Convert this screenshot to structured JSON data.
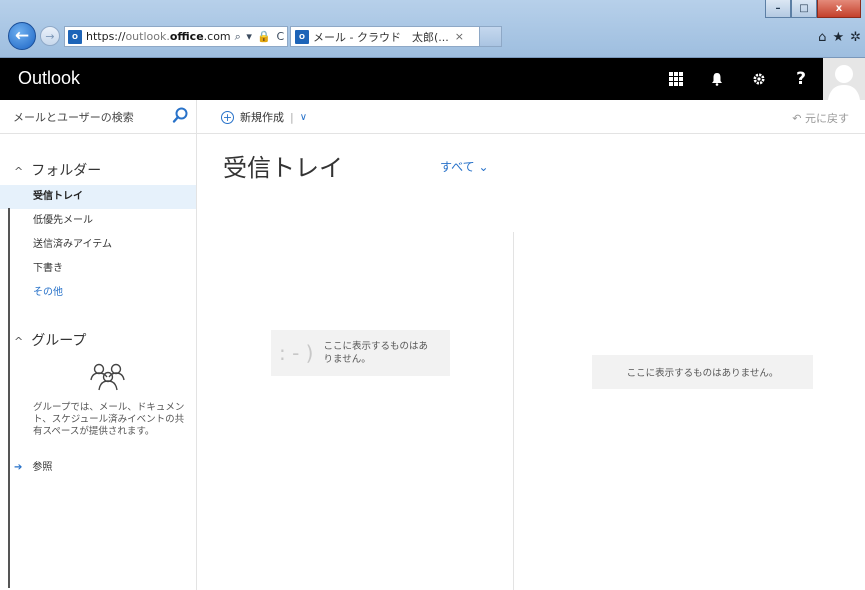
{
  "browser": {
    "url_prefix": "https://",
    "url_domain_start": "outlook.",
    "url_domain_bold": "office",
    "url_domain_end": ".com",
    "url_controls": "⌕ ▾ 🔒 C",
    "tab_title": "メール - クラウド　太郎(...",
    "tab_close": "×",
    "window_minimize": "–",
    "window_maximize": "□",
    "window_close": "x"
  },
  "app": {
    "title": "Outlook",
    "help_label": "?"
  },
  "search": {
    "placeholder": "メールとユーザーの検索"
  },
  "folders": {
    "header": "フォルダー",
    "items": [
      {
        "label": "受信トレイ",
        "selected": true
      },
      {
        "label": "低優先メール"
      },
      {
        "label": "送信済みアイテム"
      },
      {
        "label": "下書き"
      }
    ],
    "more": "その他"
  },
  "groups": {
    "header": "グループ",
    "description": "グループでは、メール、ドキュメント、スケジュール済みイベントの共有スペースが提供されます。",
    "browse": "参照"
  },
  "toolbar": {
    "new_label": "新規作成",
    "separator": "|",
    "undo_label": "元に戻す"
  },
  "main": {
    "title": "受信トレイ",
    "filter_label": "すべて",
    "empty_list_message": "ここに表示するものはありません。",
    "empty_reading_message": "ここに表示するものはありません。",
    "smiley": ": - )"
  },
  "colors": {
    "accent": "#2872c9",
    "header_bg": "#000000",
    "selected_bg": "#e6f1fb"
  }
}
